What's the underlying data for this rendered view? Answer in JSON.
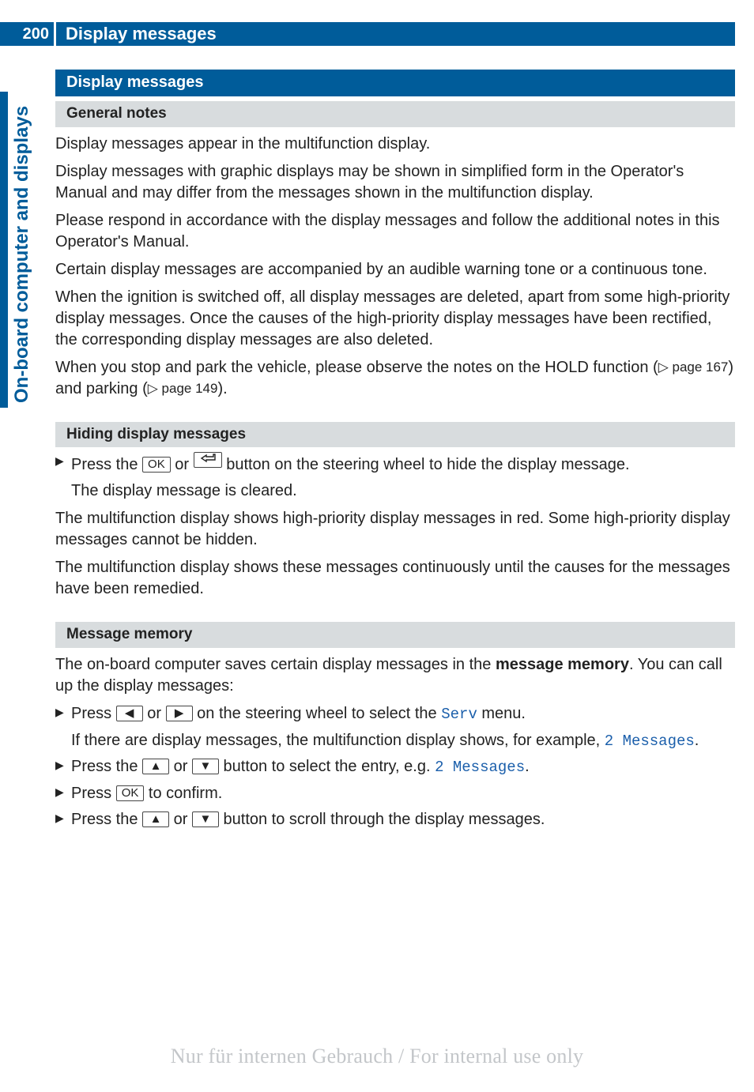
{
  "header": {
    "page_number": "200",
    "title": "Display messages"
  },
  "side_tab": "On-board computer and displays",
  "sections": {
    "s1": {
      "title": "Display messages"
    },
    "s2": {
      "title": "General notes",
      "p1": "Display messages appear in the multifunction display.",
      "p2": "Display messages with graphic displays may be shown in simplified form in the Operator's Manual and may differ from the messages shown in the multifunction display.",
      "p3": "Please respond in accordance with the display messages and follow the additional notes in this Operator's Manual.",
      "p4": "Certain display messages are accompanied by an audible warning tone or a continuous tone.",
      "p5": "When the ignition is switched off, all display messages are deleted, apart from some high-priority display messages. Once the causes of the high-priority display messages have been rectified, the corresponding display messages are also deleted.",
      "p6_a": "When you stop and park the vehicle, please observe the notes on the HOLD function (",
      "p6_ref1": "▷ page 167",
      "p6_b": ") and parking (",
      "p6_ref2": "▷ page 149",
      "p6_c": ")."
    },
    "s3": {
      "title": "Hiding display messages",
      "step1_a": "Press the ",
      "step1_b": " or ",
      "step1_c": " button on the steering wheel to hide the display message.",
      "step1_res": "The display message is cleared.",
      "p1": "The multifunction display shows high-priority display messages in red. Some high-priority display messages cannot be hidden.",
      "p2": "The multifunction display shows these messages continuously until the causes for the messages have been remedied."
    },
    "s4": {
      "title": "Message memory",
      "intro_a": "The on-board computer saves certain display messages in the ",
      "intro_strong": "message memory",
      "intro_b": ". You can call up the display messages:",
      "step1_a": "Press ",
      "step1_b": " or ",
      "step1_c": " on the steering wheel to select the ",
      "step1_menu": "Serv",
      "step1_d": " menu.",
      "step1_res_a": "If there are display messages, the multifunction display shows, for example, ",
      "step1_res_disp": "2 Messages",
      "step1_res_b": ".",
      "step2_a": "Press the ",
      "step2_b": " or ",
      "step2_c": " button to select the entry, e.g. ",
      "step2_disp": "2 Messages",
      "step2_d": ".",
      "step3_a": "Press ",
      "step3_b": " to confirm.",
      "step4_a": "Press the ",
      "step4_b": " or ",
      "step4_c": " button to scroll through the display messages."
    }
  },
  "buttons": {
    "ok": "OK"
  },
  "watermark": "Nur für internen Gebrauch / For internal use only"
}
